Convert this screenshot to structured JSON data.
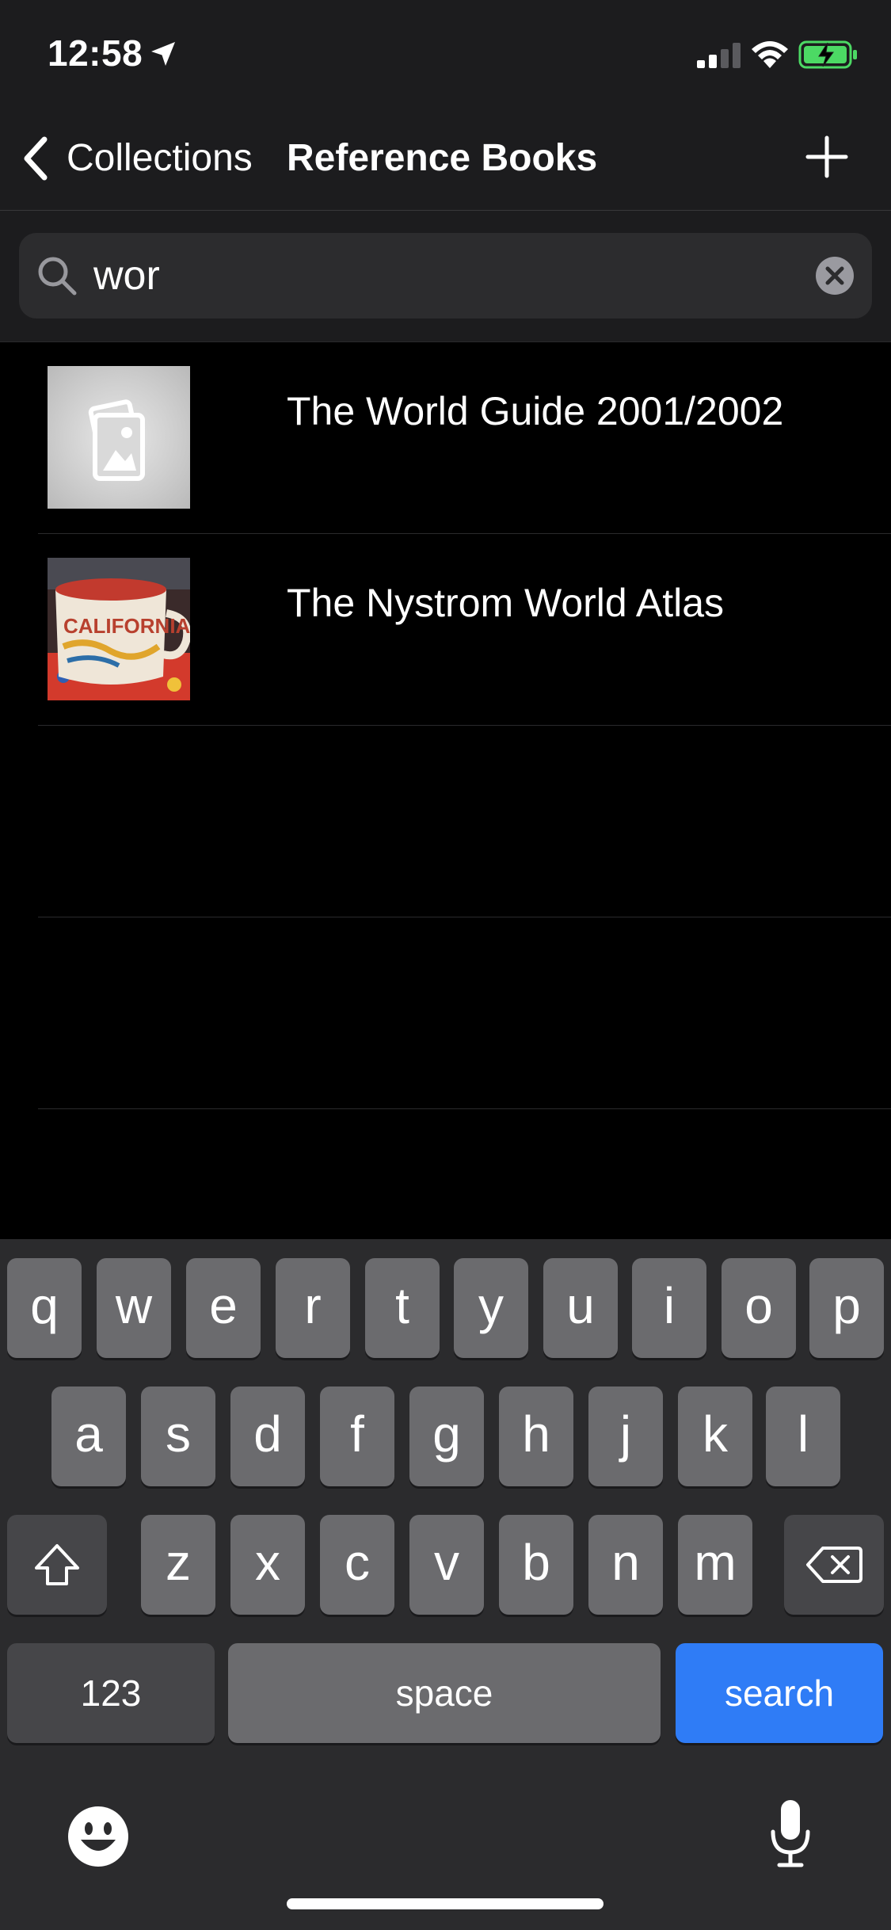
{
  "status_bar": {
    "time": "12:58"
  },
  "nav": {
    "back_label": "Collections",
    "title": "Reference Books"
  },
  "search": {
    "value": "wor"
  },
  "results": [
    {
      "title": "The World Guide 2001/2002",
      "thumbnail": "placeholder-image-icon"
    },
    {
      "title": "The Nystrom World Atlas",
      "thumbnail": "photo-california-mug"
    }
  ],
  "keyboard": {
    "row1": [
      "q",
      "w",
      "e",
      "r",
      "t",
      "y",
      "u",
      "i",
      "o",
      "p"
    ],
    "row2": [
      "a",
      "s",
      "d",
      "f",
      "g",
      "h",
      "j",
      "k",
      "l"
    ],
    "row3": [
      "z",
      "x",
      "c",
      "v",
      "b",
      "n",
      "m"
    ],
    "numbers_label": "123",
    "space_label": "space",
    "search_label": "search"
  },
  "colors": {
    "accent": "#3478f6",
    "search_key": "#2f7cf6",
    "battery_green": "#4cd964"
  }
}
